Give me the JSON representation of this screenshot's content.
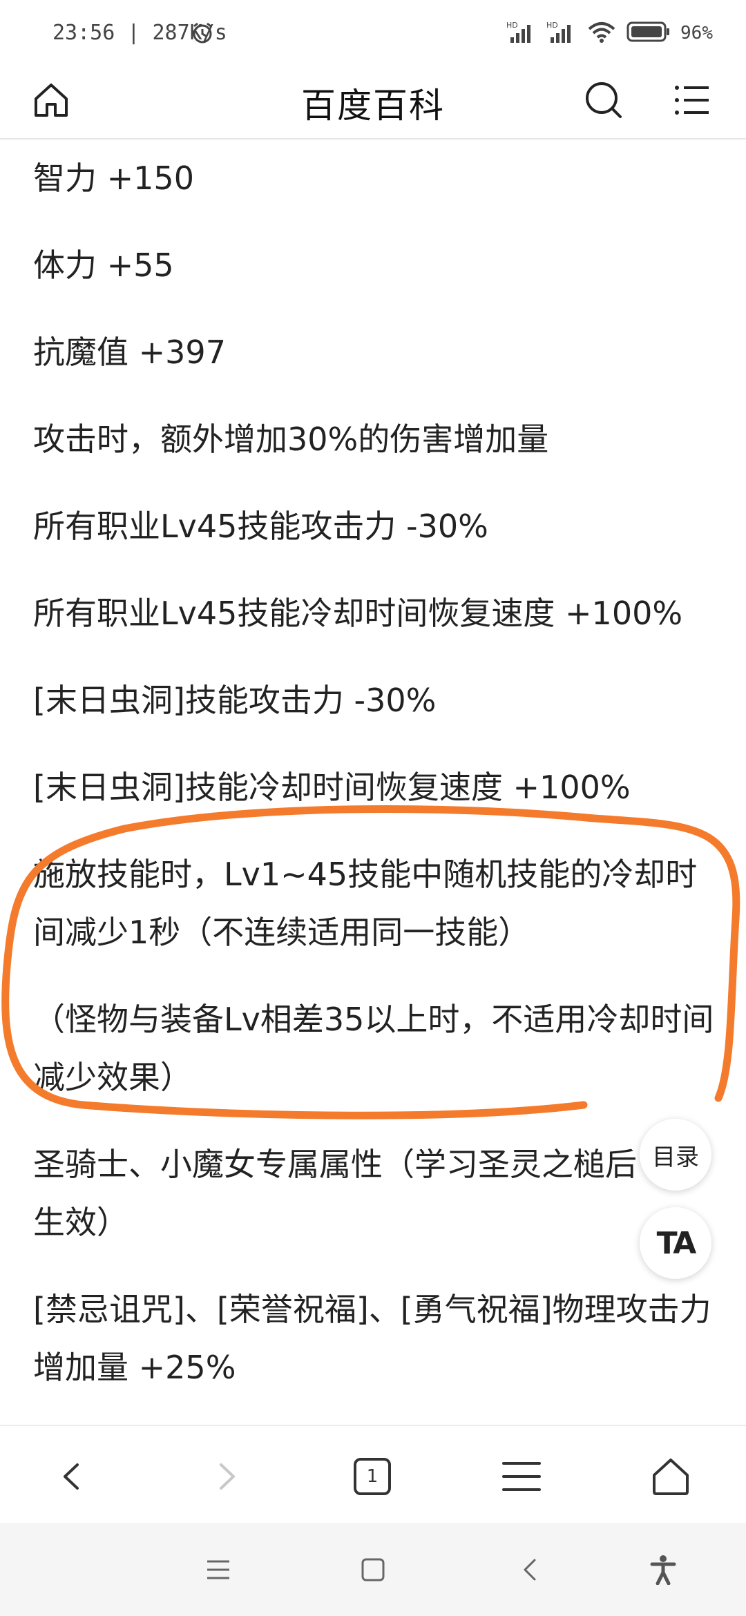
{
  "status_bar": {
    "time": "23:56 | 287K/s",
    "battery": "96%",
    "icons": [
      "alarm-icon",
      "signal-hd-icon",
      "signal-hd-icon",
      "wifi-icon",
      "battery-icon"
    ]
  },
  "header": {
    "title": "百度百科",
    "left_icon": "home-icon",
    "right_icons": [
      "search-icon",
      "menu-list-icon"
    ]
  },
  "content": {
    "attributes": [
      "智力 +150",
      "体力 +55",
      "抗魔值 +397",
      "攻击时，额外增加30%的伤害增加量",
      "所有职业Lv45技能攻击力 -30%",
      "所有职业Lv45技能冷却时间恢复速度 +100%",
      "[末日虫洞]技能攻击力 -30%",
      "[末日虫洞]技能冷却时间恢复速度 +100%"
    ],
    "highlighted": [
      "施放技能时，Lv1~45技能中随机技能的冷却时间减少1秒（不连续适用同一技能）",
      "（怪物与装备Lv相差35以上时，不适用冷却时间减少效果）"
    ],
    "after": [
      "圣骑士、小魔女专属属性（学习圣灵之槌后生效）",
      "[禁忌诅咒]、[荣誉祝福]、[勇气祝福]物理攻击力增加量 +25%"
    ],
    "annotation_color": "#f47a2c"
  },
  "floating": {
    "toc_label": "目录",
    "ta_label": "TA"
  },
  "toolbar": {
    "tab_count": "1",
    "icons": [
      "back-icon",
      "forward-icon",
      "tabs-icon",
      "menu-icon",
      "home-icon"
    ]
  },
  "system_nav": {
    "icons": [
      "recents-icon",
      "home-square-icon",
      "back-triangle-icon",
      "accessibility-icon"
    ]
  }
}
